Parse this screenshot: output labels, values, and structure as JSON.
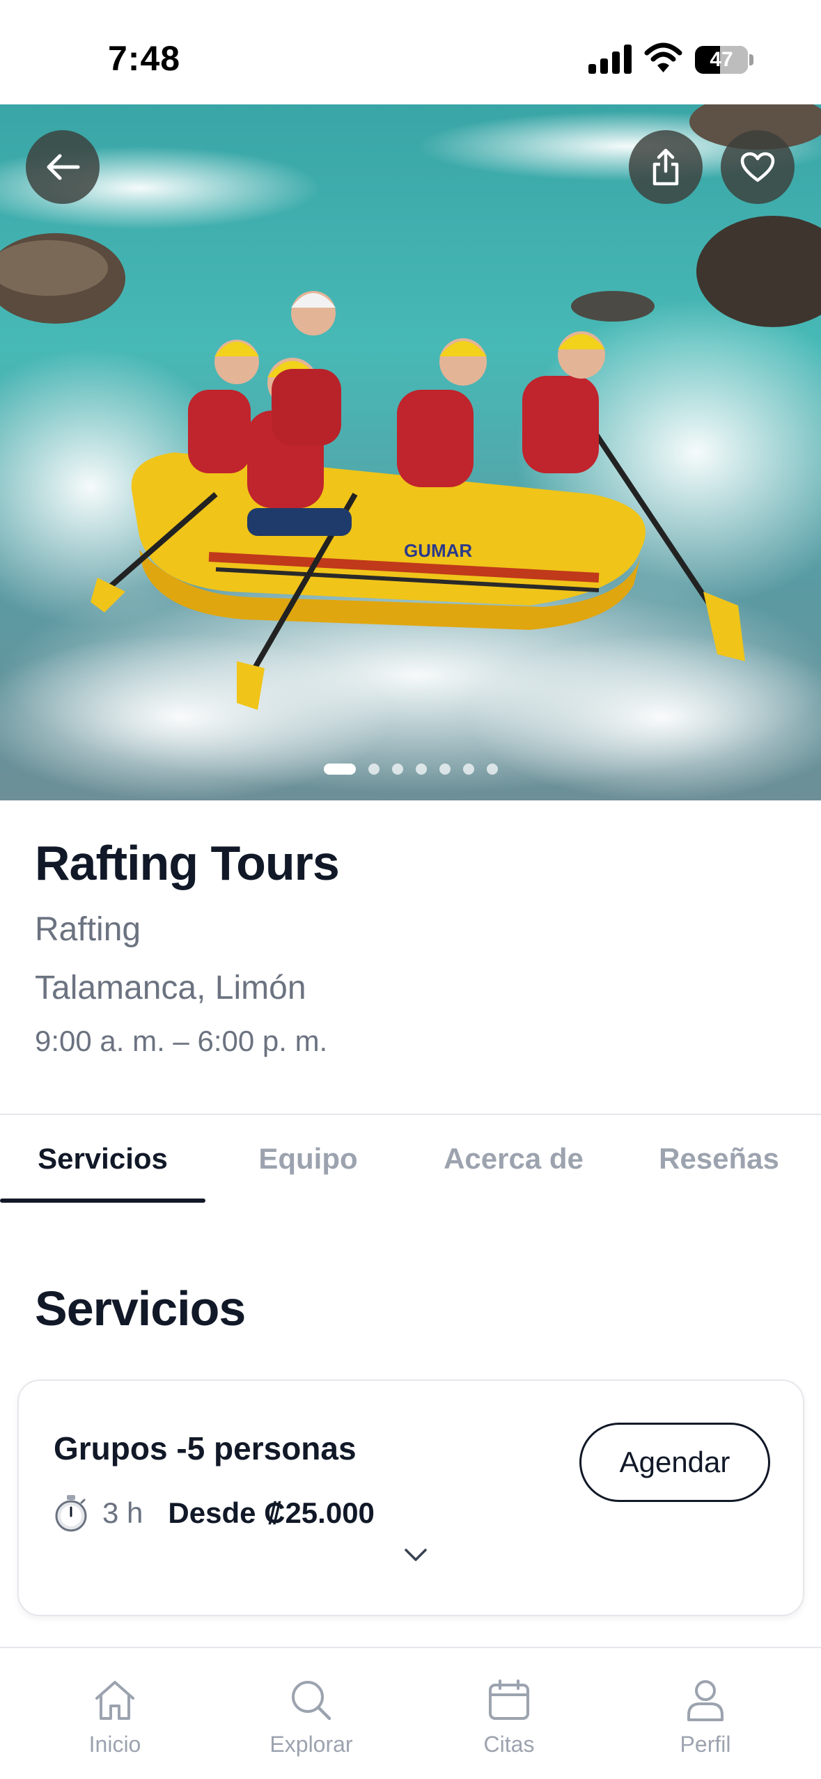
{
  "status_bar": {
    "time": "7:48",
    "battery": "47",
    "battery_fraction": 0.47
  },
  "hero": {
    "image_description": "",
    "slide_count": 7,
    "active_slide": 1,
    "back_icon": "arrow-left-icon",
    "share_icon": "share-icon",
    "favorite_icon": "heart-icon"
  },
  "business": {
    "name": "Rafting Tours",
    "category": "Rafting",
    "location": "Talamanca, Limón",
    "hours": "9:00 a. m. – 6:00 p. m."
  },
  "tabs": [
    {
      "label": "Servicios",
      "active": true
    },
    {
      "label": "Equipo",
      "active": false
    },
    {
      "label": "Acerca de",
      "active": false
    },
    {
      "label": "Reseñas",
      "active": false
    }
  ],
  "services_section": {
    "title": "Servicios",
    "items": [
      {
        "name": "Grupos -5 personas",
        "duration": "3 h",
        "price": "Desde ₡25.000",
        "book_label": "Agendar",
        "duration_icon": "stopwatch-icon",
        "expand_icon": "chevron-down-icon"
      }
    ]
  },
  "bottom_nav": [
    {
      "label": "Inicio",
      "icon": "home-icon"
    },
    {
      "label": "Explorar",
      "icon": "search-icon"
    },
    {
      "label": "Citas",
      "icon": "calendar-icon"
    },
    {
      "label": "Perfil",
      "icon": "user-icon"
    }
  ],
  "colors": {
    "text_primary": "#111827",
    "text_secondary": "#6b7280",
    "tab_inactive": "#9ca3af",
    "border": "#e5e7eb"
  }
}
